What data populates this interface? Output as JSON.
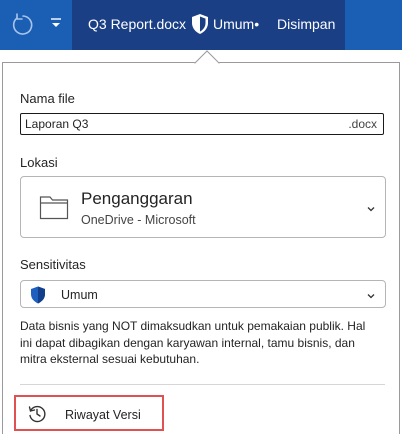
{
  "titlebar": {
    "document_name": "Q3 Report.docx",
    "sensitivity_label": "Umum•",
    "save_status": "Disimpan",
    "icons": [
      "undo-icon",
      "chevron-down-icon",
      "shield-icon"
    ],
    "colors": {
      "bar": "#1b5fb4",
      "doc_area": "#1a3f85"
    }
  },
  "file_name": {
    "label": "Nama file",
    "value": "Laporan Q3",
    "extension": ".docx"
  },
  "location": {
    "label": "Lokasi",
    "folder": "Penganggaran",
    "service": "OneDrive - Microsoft",
    "icons": [
      "folder-icon",
      "chevron-down-icon"
    ]
  },
  "sensitivity": {
    "label": "Sensitivitas",
    "selected": "Umum",
    "description": "Data bisnis yang NOT dimaksudkan untuk pemakaian publik. Hal ini dapat dibagikan dengan karyawan internal, tamu bisnis, dan mitra eksternal sesuai kebutuhan.",
    "icons": [
      "shield-icon",
      "chevron-down-icon"
    ]
  },
  "version_history": {
    "label": "Riwayat Versi",
    "icon": "history-icon",
    "highlight_color": "#e05252"
  }
}
